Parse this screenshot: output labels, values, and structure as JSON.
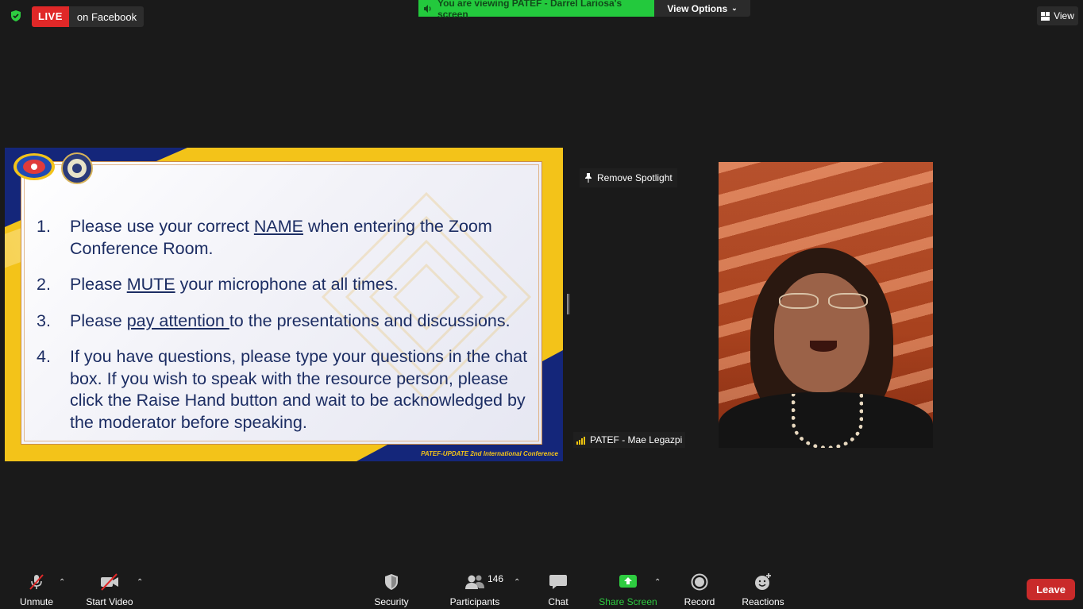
{
  "top": {
    "live_label": "LIVE",
    "live_platform": "on Facebook",
    "viewing_banner": "You are viewing PATEF - Darrel Lariosa's screen",
    "view_options": "View Options",
    "view_button": "View"
  },
  "slide": {
    "rules": [
      {
        "num": "1.",
        "pre": "Please use your correct ",
        "emph": "NAME",
        "post": " when entering the Zoom Conference Room."
      },
      {
        "num": "2.",
        "pre": "Please ",
        "emph": "MUTE",
        "post": " your microphone at all times."
      },
      {
        "num": "3.",
        "pre": "Please ",
        "emph": "pay attention ",
        "post": "to the presentations and discussions."
      },
      {
        "num": "4.",
        "pre": "If you have questions, please type your questions in the chat box. If you wish to speak with the resource person, please click the Raise Hand button and wait to be acknowledged by the moderator before speaking.",
        "emph": "",
        "post": ""
      }
    ],
    "footer": "PATEF-UPDATE 2nd International Conference"
  },
  "spotlight": {
    "remove_label": "Remove Spotlight"
  },
  "participant": {
    "name": "PATEF - Mae Legazpi"
  },
  "toolbar": {
    "unmute": "Unmute",
    "start_video": "Start Video",
    "security": "Security",
    "participants": "Participants",
    "participants_count": "146",
    "chat": "Chat",
    "share_screen": "Share Screen",
    "record": "Record",
    "reactions": "Reactions",
    "leave": "Leave"
  },
  "colors": {
    "accent_green": "#23c93d",
    "live_red": "#e02828",
    "leave_red": "#c92a2a",
    "slide_navy": "#14267a",
    "slide_gold": "#f3c319",
    "slide_text": "#1c2d63"
  }
}
